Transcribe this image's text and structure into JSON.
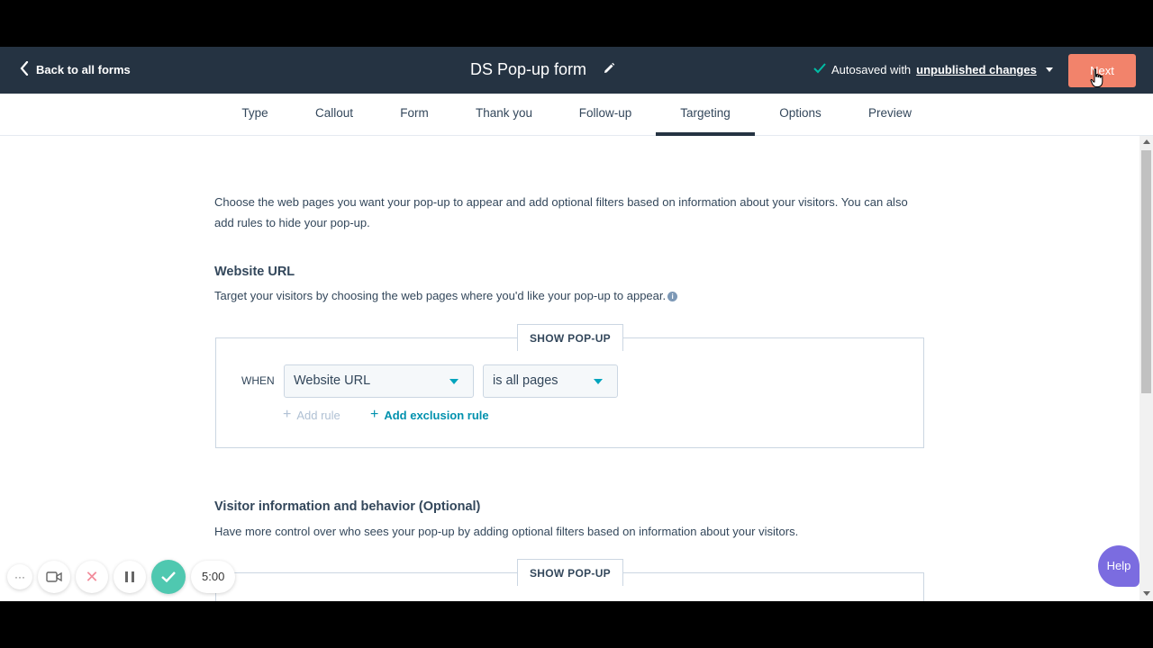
{
  "header": {
    "back_label": "Back to all forms",
    "form_title": "DS Pop-up form",
    "autosave_prefix": "Autosaved with",
    "autosave_link": "unpublished changes",
    "next_label": "Next"
  },
  "tabs": [
    {
      "label": "Type"
    },
    {
      "label": "Callout"
    },
    {
      "label": "Form"
    },
    {
      "label": "Thank you"
    },
    {
      "label": "Follow-up"
    },
    {
      "label": "Targeting"
    },
    {
      "label": "Options"
    },
    {
      "label": "Preview"
    }
  ],
  "active_tab": "Targeting",
  "main": {
    "intro": "Choose the web pages you want your pop-up to appear and add optional filters based on information about your visitors. You can also add rules to hide your pop-up.",
    "website_url": {
      "title": "Website URL",
      "desc": "Target your visitors by choosing the web pages where you'd like your pop-up to appear.",
      "box_label": "SHOW POP-UP",
      "when_label": "WHEN",
      "field_select": "Website URL",
      "condition_select": "is all pages",
      "add_rule": "Add rule",
      "add_exclusion": "Add exclusion rule"
    },
    "visitor": {
      "title": "Visitor information and behavior (Optional)",
      "desc": "Have more control over who sees your pop-up by adding optional filters based on information about your visitors.",
      "box_label": "SHOW POP-UP"
    }
  },
  "help_label": "Help",
  "recorder": {
    "timer": "5:00"
  },
  "colors": {
    "header_bg": "#253342",
    "next_button": "#f2836b",
    "accent_teal": "#00a4bd",
    "help_purple": "#7b6ce0",
    "text": "#33475b"
  }
}
